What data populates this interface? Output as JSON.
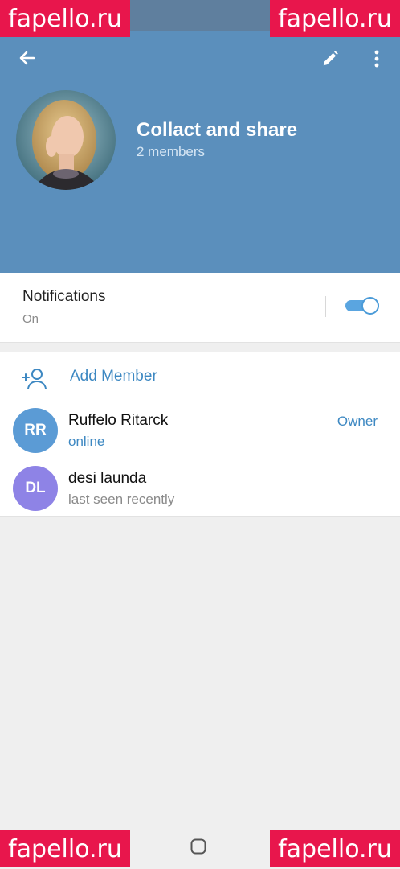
{
  "header": {
    "title": "Collact and share",
    "subtitle": "2 members"
  },
  "notifications": {
    "label": "Notifications",
    "value": "On",
    "enabled": true
  },
  "members_section": {
    "add_label": "Add Member",
    "members": [
      {
        "initials": "RR",
        "name": "Ruffelo Ritarck",
        "status": "online",
        "role": "Owner",
        "avatar_color": "#5b9bd5",
        "status_color": "#3d88c2"
      },
      {
        "initials": "DL",
        "name": "desi launda",
        "status": "last seen recently",
        "role": "",
        "avatar_color": "#8e83e6",
        "status_color": "#8a8a8a"
      }
    ]
  },
  "watermark": {
    "text": "fapello.ru"
  },
  "colors": {
    "header_bg": "#5b8fbc",
    "accent": "#3d88c2",
    "watermark_bg": "#e8164c"
  },
  "icons": [
    "back-arrow-icon",
    "pencil-icon",
    "more-vertical-icon",
    "add-person-icon",
    "home-icon"
  ]
}
